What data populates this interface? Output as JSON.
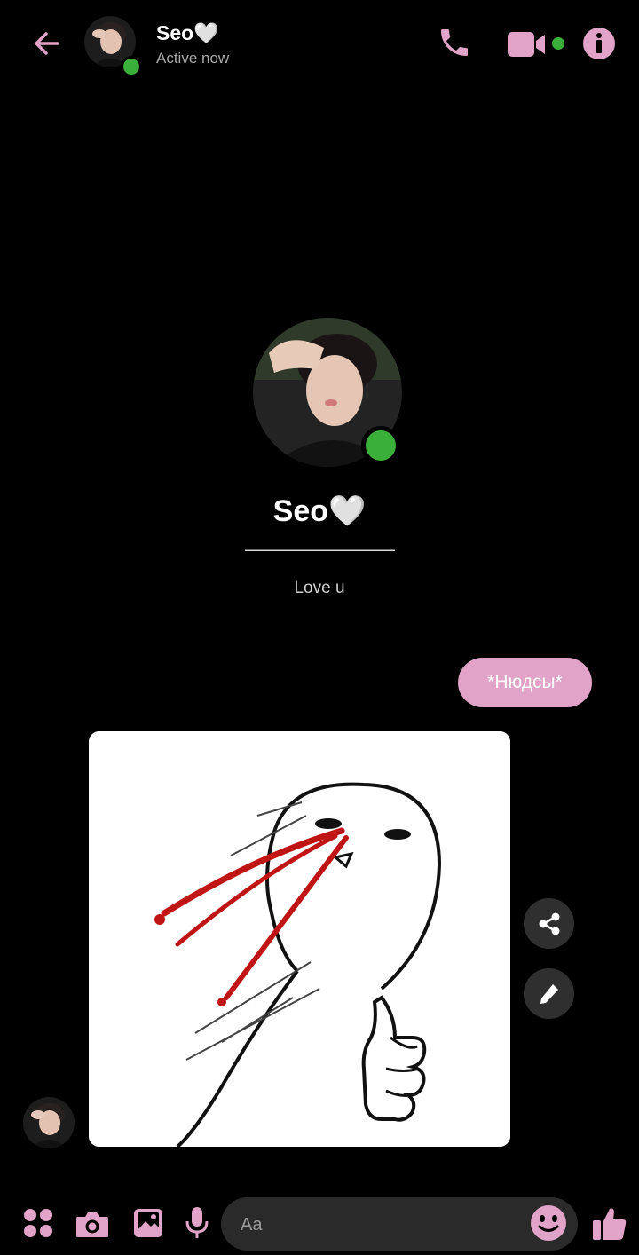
{
  "colors": {
    "accent": "#e2a3c8",
    "online": "#3ab03a",
    "background": "#000000"
  },
  "header": {
    "name": "Seo🤍",
    "status": "Active now",
    "icons": [
      "back-arrow-icon",
      "phone-icon",
      "video-camera-icon",
      "info-icon"
    ]
  },
  "profile": {
    "name": "Seo🤍",
    "divider": "————————",
    "bio": "Love u"
  },
  "messages": [
    {
      "direction": "outgoing",
      "type": "text",
      "text": "*Нюдсы*"
    },
    {
      "direction": "incoming",
      "type": "image",
      "description_icon": "meme-sticker"
    }
  ],
  "composer": {
    "placeholder": "Aa",
    "icons": [
      "apps-icon",
      "camera-icon",
      "gallery-icon",
      "microphone-icon",
      "emoji-icon",
      "thumbs-up-icon"
    ]
  }
}
